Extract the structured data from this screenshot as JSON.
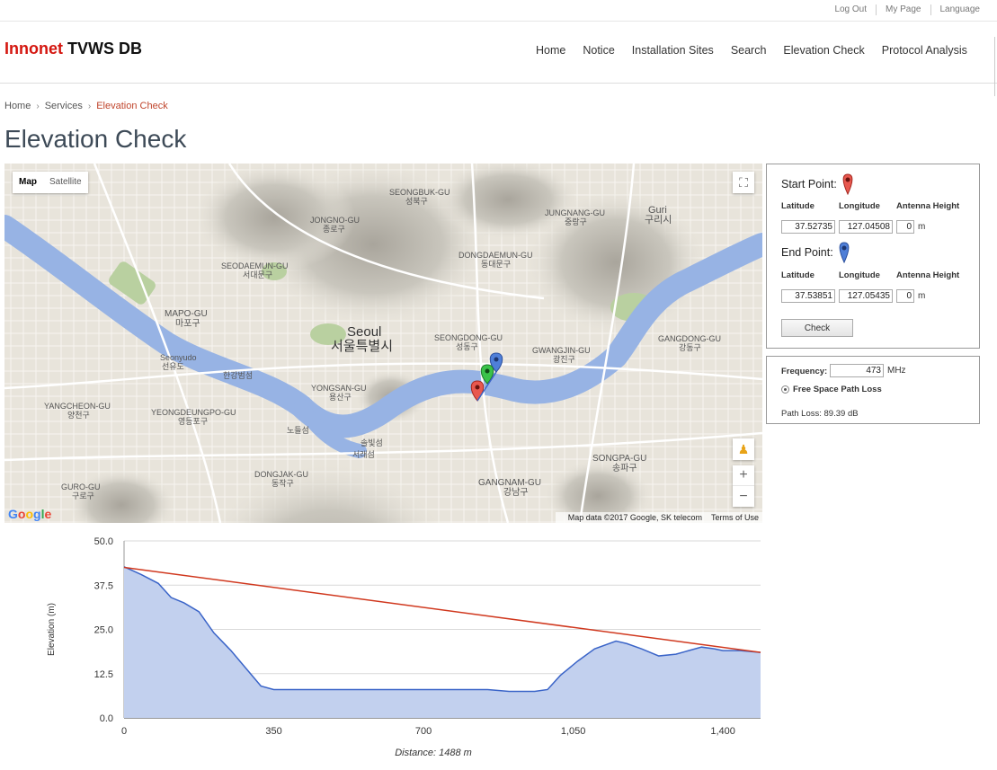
{
  "toplinks": {
    "logout": "Log Out",
    "mypage": "My Page",
    "language": "Language"
  },
  "logo": {
    "brand": "Innonet",
    "product": "TVWS DB",
    "brand_color": "#d4160f"
  },
  "nav": [
    "Home",
    "Notice",
    "Installation Sites",
    "Search",
    "Elevation Check",
    "Protocol Analysis"
  ],
  "breadcrumb": {
    "home": "Home",
    "services": "Services",
    "current": "Elevation Check"
  },
  "page_title": "Elevation Check",
  "map": {
    "types": [
      "Map",
      "Satellite"
    ],
    "selected_type": "Map",
    "google_logo": "Google",
    "attribution": "Map data ©2017 Google, SK telecom",
    "terms": "Terms of Use",
    "zoom_in": "+",
    "zoom_out": "−",
    "fullscreen_icon": "⛶",
    "pegman_icon": "♟",
    "labels": {
      "seongbuk_en": "SEONGBUK-GU",
      "seongbuk_ko": "성북구",
      "jongno_en": "JONGNO-GU",
      "jongno_ko": "종로구",
      "jungnang_en": "JUNGNANG-GU",
      "jungnang_ko": "중랑구",
      "guri_en": "Guri",
      "guri_ko": "구리시",
      "seodaemun_en": "SEODAEMUN-GU",
      "seodaemun_ko": "서대문구",
      "dongdaemun_en": "DONGDAEMUN-GU",
      "dongdaemun_ko": "동대문구",
      "mapo_en": "MAPO-GU",
      "mapo_ko": "마포구",
      "seoul_en": "Seoul",
      "seoul_ko": "서울특별시",
      "seongdong_en": "SEONGDONG-GU",
      "seongdong_ko": "성동구",
      "gwangjin_en": "GWANGJIN-GU",
      "gwangjin_ko": "광진구",
      "gangdong_en": "GANGDONG-GU",
      "gangdong_ko": "강동구",
      "seonyudo_en": "Seonyudo",
      "seonyudo_ko": "선유도",
      "hangang": "한강범섬",
      "yongsan_en": "YONGSAN-GU",
      "yongsan_ko": "용산구",
      "yangcheon_en": "YANGCHEON-GU",
      "yangcheon_ko": "양천구",
      "yeongdeungpo_en": "YEONGDEUNGPO-GU",
      "yeongdeungpo_ko": "영등포구",
      "nodeulseom": "노들섬",
      "seoraeseom_a": "솔빛섬",
      "seoraeseom_b": "서래섬",
      "songpa_en": "SONGPA-GU",
      "songpa_ko": "송파구",
      "dongjak_en": "DONGJAK-GU",
      "dongjak_ko": "동작구",
      "gangnam_en": "GANGNAM-GU",
      "gangnam_ko": "강남구",
      "guro_en": "GURO-GU",
      "guro_ko": "구로구"
    },
    "colors": {
      "land": "#e7e3da",
      "water": "#97b3e4",
      "park": "#b9d0a0"
    }
  },
  "start_point": {
    "label": "Start Point:",
    "latitude": "37.52735",
    "longitude": "127.04508",
    "antenna_height": "0",
    "pin_color": "#e8584f"
  },
  "end_point": {
    "label": "End Point:",
    "latitude": "37.53851",
    "longitude": "127.05435",
    "antenna_height": "0",
    "pin_color": "#4f7fd8"
  },
  "columns": {
    "latitude": "Latitude",
    "longitude": "Longitude",
    "antenna_height": "Antenna Height",
    "unit_m": "m"
  },
  "check_button": "Check",
  "frequency": {
    "label": "Frequency:",
    "value": "473",
    "unit": "MHz"
  },
  "method": "Free Space Path Loss",
  "path_loss": "Path Loss: 89.39 dB",
  "chart_data": {
    "type": "area",
    "xlabel": "Distance: 1488 m",
    "ylabel": "Elevation (m)",
    "xlim": [
      0,
      1488
    ],
    "ylim": [
      0,
      50
    ],
    "xticks": [
      0,
      350,
      700,
      1050,
      1400
    ],
    "xtick_labels": [
      "0",
      "350",
      "700",
      "1,050",
      "1,400"
    ],
    "yticks": [
      0,
      12.5,
      25,
      37.5,
      50
    ],
    "ytick_labels": [
      "0.0",
      "12.5",
      "25.0",
      "37.5",
      "50.0"
    ],
    "grid": true,
    "series": [
      {
        "kind": "area",
        "color": "#3a64c8",
        "fill": "#c2d0ee",
        "x": [
          0,
          40,
          80,
          110,
          140,
          175,
          210,
          250,
          285,
          320,
          350,
          450,
          560,
          700,
          850,
          900,
          960,
          990,
          1020,
          1060,
          1100,
          1150,
          1175,
          1210,
          1250,
          1290,
          1320,
          1350,
          1380,
          1400,
          1440,
          1488
        ],
        "y": [
          42.7,
          40.5,
          38,
          34,
          32.5,
          30,
          24,
          19,
          14,
          9,
          8,
          8,
          8,
          8,
          8,
          7.5,
          7.5,
          8,
          12,
          16,
          19.5,
          21.7,
          21,
          19.5,
          17.5,
          18,
          19,
          20,
          19.5,
          19,
          19,
          18.5
        ]
      },
      {
        "kind": "line",
        "color": "#d0381e",
        "x": [
          0,
          1488
        ],
        "y": [
          42.5,
          18.5
        ]
      }
    ]
  }
}
